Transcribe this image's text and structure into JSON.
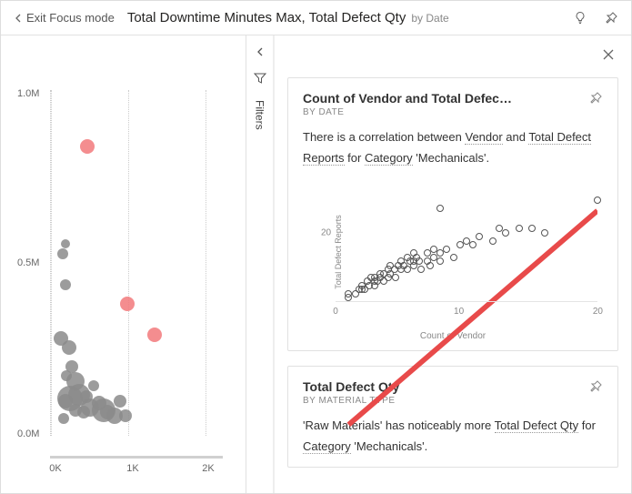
{
  "header": {
    "exit_label": "Exit Focus mode",
    "title_main": "Total Downtime Minutes Max, Total Defect Qty",
    "title_sub": "by Date"
  },
  "filters": {
    "label": "Filters"
  },
  "left_chart": {
    "yticks": [
      "1.0M",
      "0.5M",
      "0.0M"
    ],
    "xticks": [
      "0K",
      "1K",
      "2K"
    ]
  },
  "chart_data": [
    {
      "id": "left_main_scatter",
      "type": "scatter",
      "title": "Total Downtime Minutes Max, Total Defect Qty by Date",
      "xlabel": "",
      "ylabel": "",
      "xlim": [
        -200,
        2300
      ],
      "ylim": [
        -50000,
        1050000
      ],
      "series": [
        {
          "name": "normal",
          "points": [
            {
              "x": -50,
              "y": 260000,
              "r": 8
            },
            {
              "x": 10,
              "y": 560000,
              "r": 5
            },
            {
              "x": -30,
              "y": 530000,
              "r": 6
            },
            {
              "x": 15,
              "y": 430000,
              "r": 6
            },
            {
              "x": 60,
              "y": 230000,
              "r": 8
            },
            {
              "x": 100,
              "y": 170000,
              "r": 7
            },
            {
              "x": 160,
              "y": 125000,
              "r": 10
            },
            {
              "x": 210,
              "y": 80000,
              "r": 12
            },
            {
              "x": 80,
              "y": 70000,
              "r": 14
            },
            {
              "x": 10,
              "y": 60000,
              "r": 8
            },
            {
              "x": -20,
              "y": 5000,
              "r": 6
            },
            {
              "x": 30,
              "y": 140000,
              "r": 6
            },
            {
              "x": 310,
              "y": 75000,
              "r": 7
            },
            {
              "x": 370,
              "y": 40000,
              "r": 10
            },
            {
              "x": 500,
              "y": 55000,
              "r": 8
            },
            {
              "x": 560,
              "y": 30000,
              "r": 13
            },
            {
              "x": 620,
              "y": 25000,
              "r": 8
            },
            {
              "x": 720,
              "y": 15000,
              "r": 9
            },
            {
              "x": 880,
              "y": 15000,
              "r": 7
            },
            {
              "x": 800,
              "y": 60000,
              "r": 7
            },
            {
              "x": 420,
              "y": 110000,
              "r": 6
            },
            {
              "x": 270,
              "y": 25000,
              "r": 7
            },
            {
              "x": 150,
              "y": 30000,
              "r": 7
            }
          ]
        },
        {
          "name": "highlighted",
          "points": [
            {
              "x": 330,
              "y": 870000,
              "r": 8
            },
            {
              "x": 900,
              "y": 370000,
              "r": 8
            },
            {
              "x": 1300,
              "y": 270000,
              "r": 8
            }
          ]
        }
      ]
    },
    {
      "id": "right_card_scatter",
      "type": "scatter",
      "title": "Count of Vendor and Total Defect Reports by Date",
      "xlabel": "Count of Vendor",
      "ylabel": "Total Defect Reports",
      "xlim": [
        0,
        20
      ],
      "ylim": [
        0,
        30
      ],
      "yticks": [
        20
      ],
      "xticks": [
        0,
        10,
        20
      ],
      "trendline": {
        "x1": 1,
        "y1": 2,
        "x2": 20,
        "y2": 26.5
      },
      "series": [
        {
          "name": "points",
          "points": [
            {
              "x": 1,
              "y": 1
            },
            {
              "x": 1,
              "y": 2
            },
            {
              "x": 1.5,
              "y": 2
            },
            {
              "x": 1.8,
              "y": 3
            },
            {
              "x": 2,
              "y": 3
            },
            {
              "x": 2,
              "y": 4
            },
            {
              "x": 2.2,
              "y": 3
            },
            {
              "x": 2.4,
              "y": 5
            },
            {
              "x": 2.6,
              "y": 4
            },
            {
              "x": 2.7,
              "y": 6
            },
            {
              "x": 3,
              "y": 5
            },
            {
              "x": 3,
              "y": 4
            },
            {
              "x": 3,
              "y": 6
            },
            {
              "x": 3.2,
              "y": 5
            },
            {
              "x": 3.4,
              "y": 7
            },
            {
              "x": 3.4,
              "y": 6
            },
            {
              "x": 3.7,
              "y": 7
            },
            {
              "x": 3.7,
              "y": 5
            },
            {
              "x": 4,
              "y": 6
            },
            {
              "x": 4,
              "y": 8
            },
            {
              "x": 4.2,
              "y": 7
            },
            {
              "x": 4.2,
              "y": 9
            },
            {
              "x": 4.5,
              "y": 8
            },
            {
              "x": 4.6,
              "y": 6
            },
            {
              "x": 4.8,
              "y": 9
            },
            {
              "x": 5,
              "y": 8
            },
            {
              "x": 5,
              "y": 10
            },
            {
              "x": 5.2,
              "y": 9
            },
            {
              "x": 5.5,
              "y": 8
            },
            {
              "x": 5.5,
              "y": 11
            },
            {
              "x": 5.7,
              "y": 10
            },
            {
              "x": 6,
              "y": 9
            },
            {
              "x": 6,
              "y": 10
            },
            {
              "x": 6,
              "y": 12
            },
            {
              "x": 6.2,
              "y": 11
            },
            {
              "x": 6.4,
              "y": 10
            },
            {
              "x": 6.5,
              "y": 8
            },
            {
              "x": 7,
              "y": 10
            },
            {
              "x": 7,
              "y": 12
            },
            {
              "x": 7.2,
              "y": 9
            },
            {
              "x": 7.5,
              "y": 11
            },
            {
              "x": 7.5,
              "y": 13
            },
            {
              "x": 8,
              "y": 12
            },
            {
              "x": 8,
              "y": 10
            },
            {
              "x": 8,
              "y": 23
            },
            {
              "x": 8.5,
              "y": 13
            },
            {
              "x": 9,
              "y": 11
            },
            {
              "x": 9.5,
              "y": 14
            },
            {
              "x": 10,
              "y": 15
            },
            {
              "x": 10.5,
              "y": 14
            },
            {
              "x": 11,
              "y": 16
            },
            {
              "x": 12,
              "y": 15
            },
            {
              "x": 12.5,
              "y": 18
            },
            {
              "x": 13,
              "y": 17
            },
            {
              "x": 14,
              "y": 18
            },
            {
              "x": 15,
              "y": 18
            },
            {
              "x": 16,
              "y": 17
            },
            {
              "x": 20,
              "y": 25
            }
          ]
        }
      ]
    }
  ],
  "card1": {
    "title": "Count of Vendor and Total Defec…",
    "subtitle": "BY DATE",
    "text_pre": "There is a correlation between ",
    "link1": "Vendor",
    "text_mid1": " and ",
    "link2": "Total Defect Reports",
    "text_mid2": " for ",
    "link3": "Category",
    "text_end": " 'Mechanicals'.",
    "xlabel": "Count of Vendor",
    "ylabel": "Total Defect Reports",
    "ytick": "20",
    "xticks": [
      "0",
      "10",
      "20"
    ]
  },
  "card2": {
    "title": "Total Defect Qty",
    "subtitle": "BY MATERIAL TYPE",
    "text_pre": "'Raw Materials' has noticeably more ",
    "link1": "Total Defect Qty",
    "text_mid": " for ",
    "link2": "Category",
    "text_end": " 'Mechanicals'."
  }
}
